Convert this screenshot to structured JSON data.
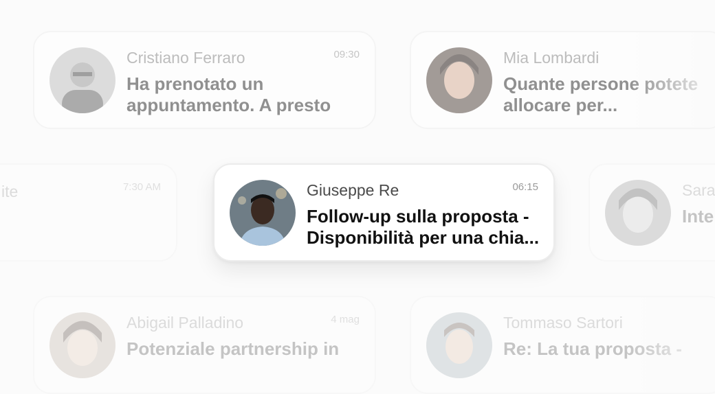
{
  "notifications": [
    {
      "name": "Cristiano Ferraro",
      "time": "09:30",
      "message": "Ha prenotato un appuntamento. A presto",
      "avatar_icon": "avatar-man-beard-icon"
    },
    {
      "name": "Mia Lombardi",
      "time": "",
      "message": "Quante persone potete allocare per...",
      "avatar_icon": "avatar-woman-icon"
    },
    {
      "name": "",
      "time": "7:30 AM",
      "message": "",
      "partial_text": "ite"
    },
    {
      "name": "Giuseppe Re",
      "time": "06:15",
      "message": "Follow-up sulla proposta - Disponibilità per una chia...",
      "avatar_icon": "avatar-man-icon"
    },
    {
      "name": "Sara",
      "time": "",
      "message": "Inte",
      "avatar_icon": "avatar-woman-icon"
    },
    {
      "name": "Abigail Palladino",
      "time": "4 mag",
      "message": "Potenziale partnership in",
      "avatar_icon": "avatar-woman-icon"
    },
    {
      "name": "Tommaso Sartori",
      "time": "",
      "message": "Re: La tua proposta -",
      "avatar_icon": "avatar-man-icon"
    }
  ],
  "colors": {
    "background": "#fbfbfb",
    "card": "#ffffff",
    "border": "#f0f0f0"
  }
}
